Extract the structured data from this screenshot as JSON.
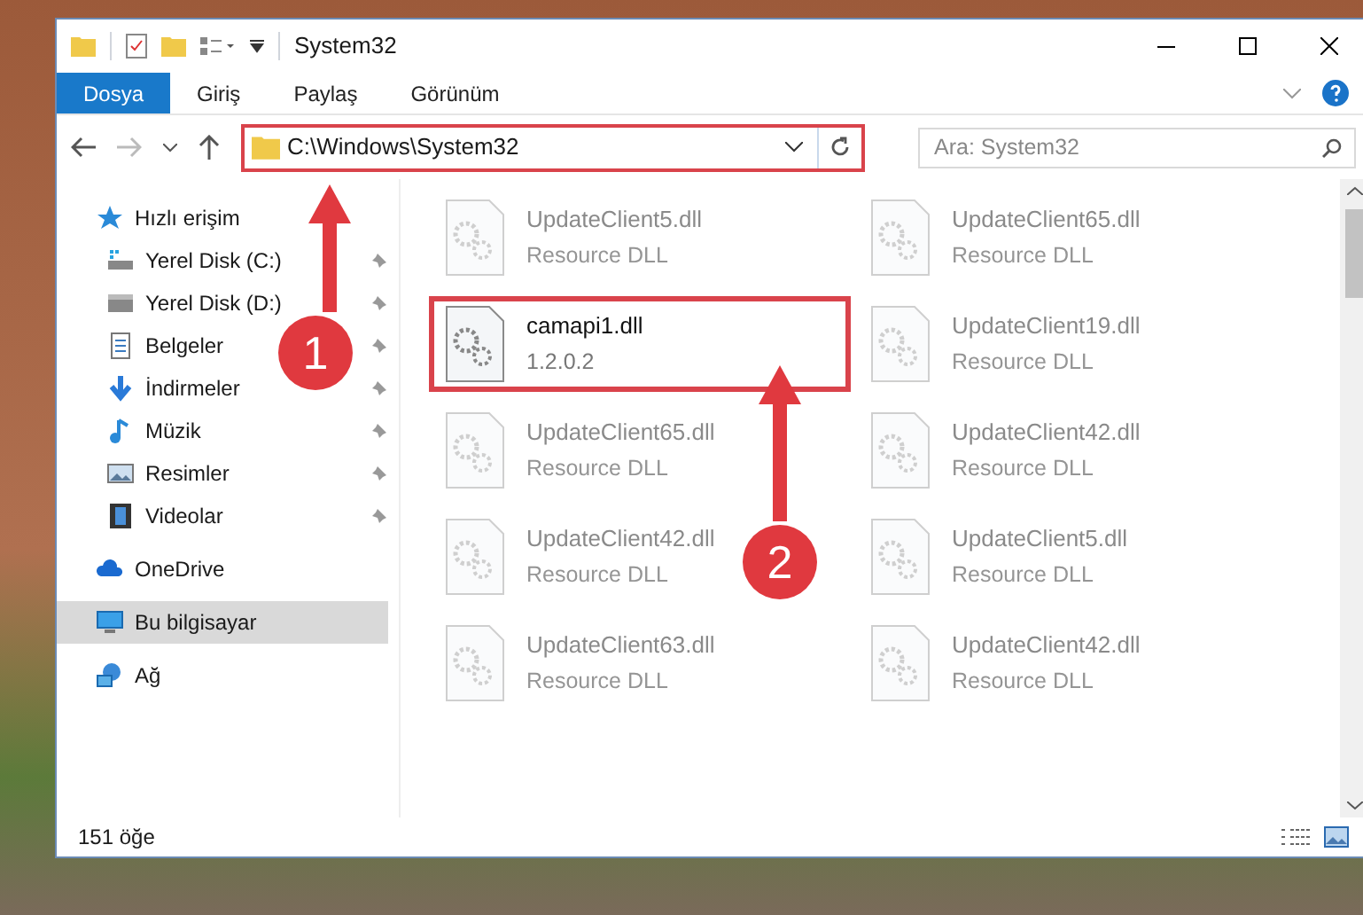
{
  "window": {
    "title": "System32"
  },
  "ribbon_tabs": [
    {
      "label": "Dosya",
      "selected": true
    },
    {
      "label": "Giriş",
      "selected": false
    },
    {
      "label": "Paylaş",
      "selected": false
    },
    {
      "label": "Görünüm",
      "selected": false
    }
  ],
  "address": {
    "path": "C:\\Windows\\System32",
    "highlighted": true
  },
  "search": {
    "placeholder": "Ara: System32"
  },
  "sidebar": {
    "items": [
      {
        "label": "Hızlı erişim",
        "kind": "star",
        "selected": false,
        "children": [
          {
            "label": "Yerel Disk (C:)",
            "kind": "drive-c",
            "selected": false,
            "pinned": true
          },
          {
            "label": "Yerel Disk (D:)",
            "kind": "drive",
            "selected": false,
            "pinned": true
          },
          {
            "label": "Belgeler",
            "kind": "document",
            "selected": false,
            "pinned": true
          },
          {
            "label": "İndirmeler",
            "kind": "download",
            "selected": false,
            "pinned": true
          },
          {
            "label": "Müzik",
            "kind": "music",
            "selected": false,
            "pinned": true
          },
          {
            "label": "Resimler",
            "kind": "picture",
            "selected": false,
            "pinned": true
          },
          {
            "label": "Videolar",
            "kind": "video",
            "selected": false,
            "pinned": true
          }
        ]
      },
      {
        "label": "OneDrive",
        "kind": "cloud",
        "selected": false
      },
      {
        "label": "Bu bilgisayar",
        "kind": "computer",
        "selected": true
      },
      {
        "label": "Ağ",
        "kind": "network",
        "selected": false
      }
    ]
  },
  "files": [
    {
      "name": "UpdateClient5.dll",
      "detail": "Resource DLL",
      "highlighted": false
    },
    {
      "name": "UpdateClient65.dll",
      "detail": "Resource DLL",
      "highlighted": false
    },
    {
      "name": "camapi1.dll",
      "detail": "1.2.0.2",
      "highlighted": true
    },
    {
      "name": "UpdateClient19.dll",
      "detail": "Resource DLL",
      "highlighted": false
    },
    {
      "name": "UpdateClient65.dll",
      "detail": "Resource DLL",
      "highlighted": false
    },
    {
      "name": "UpdateClient42.dll",
      "detail": "Resource DLL",
      "highlighted": false
    },
    {
      "name": "UpdateClient42.dll",
      "detail": "Resource DLL",
      "highlighted": false
    },
    {
      "name": "UpdateClient5.dll",
      "detail": "Resource DLL",
      "highlighted": false
    },
    {
      "name": "UpdateClient63.dll",
      "detail": "Resource DLL",
      "highlighted": false
    },
    {
      "name": "UpdateClient42.dll",
      "detail": "Resource DLL",
      "highlighted": false
    }
  ],
  "status_bar": {
    "count": "151 öğe"
  },
  "annotations": [
    {
      "number": "1"
    },
    {
      "number": "2"
    }
  ]
}
